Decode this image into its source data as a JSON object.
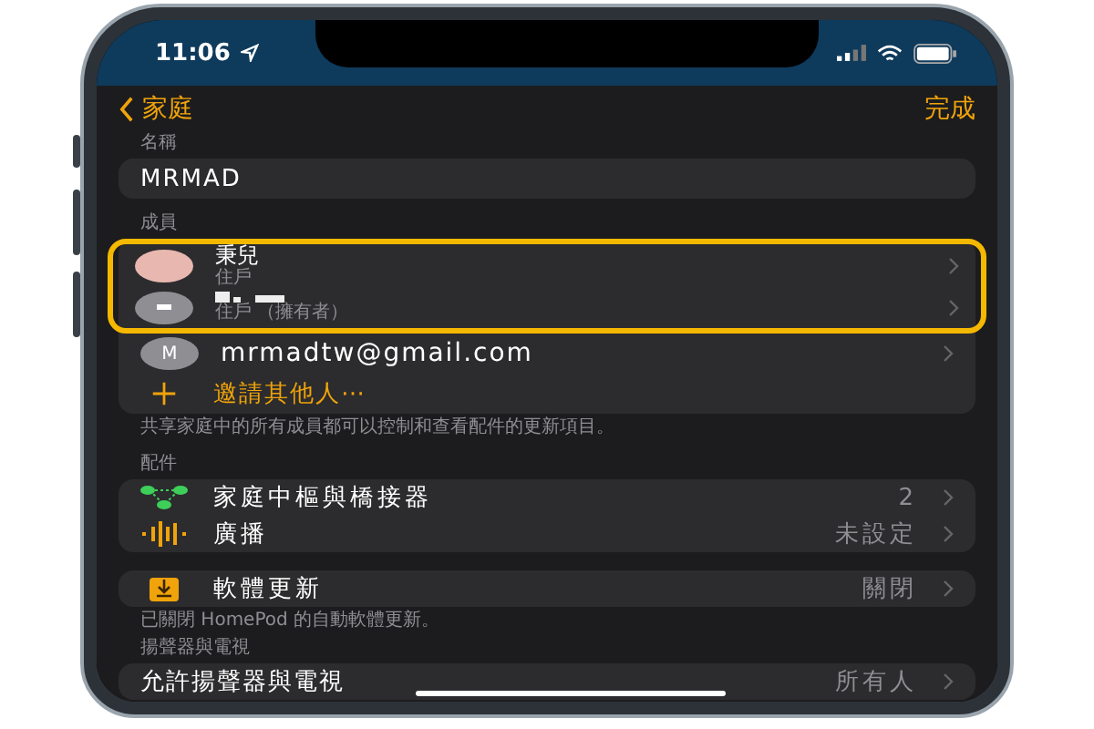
{
  "status_bar": {
    "time": "11:06"
  },
  "nav": {
    "back": "家庭",
    "done": "完成"
  },
  "name_section": {
    "label": "名稱",
    "value": "MRMAD"
  },
  "members_section": {
    "label": "成員",
    "members": [
      {
        "kind": "photo",
        "name": "秉兒",
        "role": "住戶",
        "highlighted": true
      },
      {
        "kind": "redacted",
        "role": "住戶 （擁有者）",
        "highlighted": true
      },
      {
        "kind": "initial",
        "initial": "M",
        "name": "mrmadtw@gmail.com",
        "highlighted": false
      }
    ],
    "invite": "邀請其他人⋯",
    "footer": "共享家庭中的所有成員都可以控制和查看配件的更新項目。"
  },
  "accessories_section": {
    "label": "配件",
    "rows": [
      {
        "kind": "hub",
        "title": "家庭中樞與橋接器",
        "value": "2"
      },
      {
        "kind": "broadcast",
        "title": "廣播",
        "value": "未設定"
      }
    ]
  },
  "update_section": {
    "rows": [
      {
        "kind": "update",
        "title": "軟體更新",
        "value": "關閉"
      }
    ],
    "footer": "已關閉 HomePod 的自動軟體更新。"
  },
  "speakers_section": {
    "label": "揚聲器與電視",
    "rows": [
      {
        "kind": "plain",
        "title": "允許揚聲器與電視",
        "value": "所有人"
      }
    ]
  }
}
